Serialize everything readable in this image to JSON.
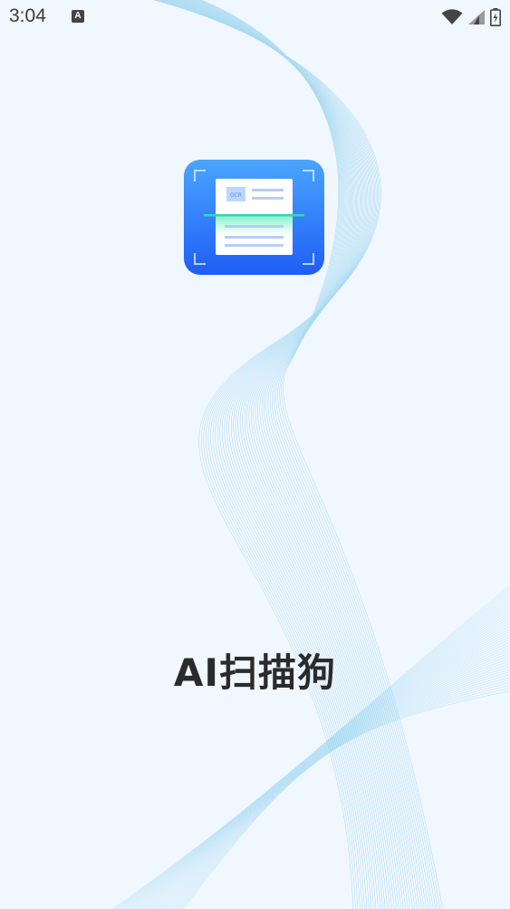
{
  "status_bar": {
    "time": "3:04",
    "notification_glyph": "A",
    "icons": [
      "wifi-icon",
      "cellular-signal-icon",
      "battery-charging-icon"
    ]
  },
  "splash": {
    "app_name": "AI扫描狗",
    "logo_badge_text": "OCR"
  },
  "colors": {
    "background": "#f1f7fe",
    "wave_line": "#6ec3e8",
    "icon_gradient_top": "#4aa5ff",
    "icon_gradient_bottom": "#1f5ef5",
    "scan_line": "#36d6b3",
    "title_text": "#2b2b2b"
  }
}
